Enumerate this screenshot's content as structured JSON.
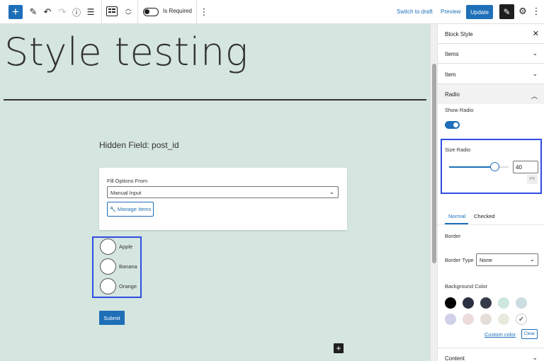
{
  "toolbar": {
    "inserter_icon": "plus-icon",
    "is_required_label": "Is Required",
    "switch_to_draft": "Switch to draft",
    "preview": "Preview",
    "update": "Update"
  },
  "canvas": {
    "post_title": "Style testing",
    "hidden_field": "Hidden Field: post_id",
    "fill_options_label": "Fill Options From",
    "fill_options_value": "Manual Input",
    "manage_items": "Manage Items",
    "radio_options": [
      "Apple",
      "Banana",
      "Orange"
    ],
    "submit": "Submit",
    "background": "#d5e5e0"
  },
  "sidebar": {
    "title": "Block Style",
    "panels": {
      "items": "Items",
      "item": "Item",
      "radio": "Radio",
      "content": "Content"
    },
    "show_radio_label": "Show Radio",
    "show_radio_on": true,
    "size_radio_label": "Size Radio",
    "size_radio_value": "40",
    "size_unit": "PX",
    "slider_fraction": 0.77,
    "tabs": [
      "Normal",
      "Checked"
    ],
    "border_label": "Border",
    "border_type_label": "Border Type",
    "border_type_value": "None",
    "background_color_label": "Background Color",
    "swatches": [
      "#000000",
      "#2b3140",
      "#353b48",
      "#cde6e0",
      "#cbdde0",
      "#d0d0e8",
      "#eddbdb",
      "#e5ddd7",
      "#e9e9dd",
      "#ffffff"
    ],
    "custom_color": "Custom color",
    "clear": "Clear"
  },
  "colors": {
    "accent": "#1e6fb8",
    "highlight_border": "#2f4de2"
  }
}
